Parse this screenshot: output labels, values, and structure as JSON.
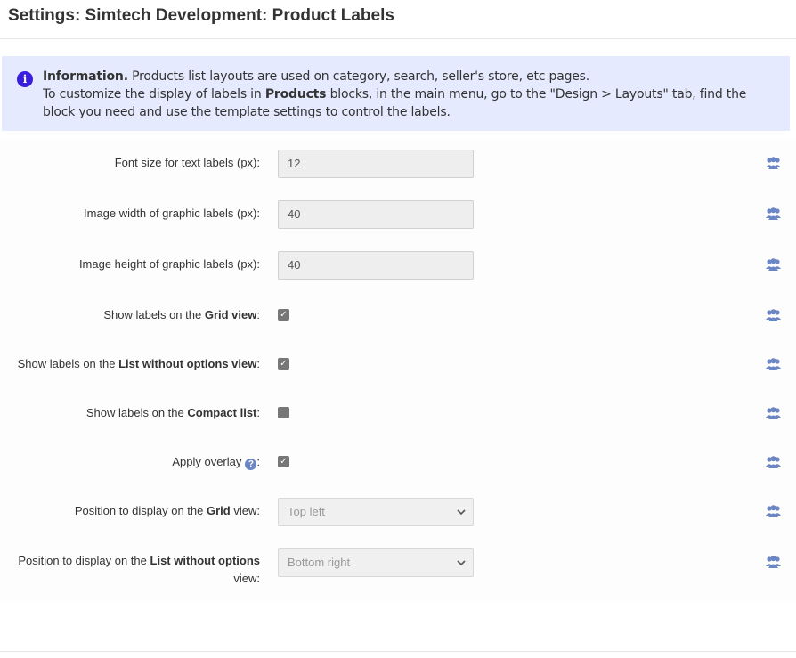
{
  "title": "Settings: Simtech Development: Product Labels",
  "info": {
    "heading": "Information.",
    "line1": "Products list layouts are used on category, search, seller's store, etc pages.",
    "line2_prefix": "To customize the display of labels in",
    "line2_bold": "Products",
    "line2_suffix": "blocks, in the main menu, go to the \"Design > Layouts\" tab, find the block you need and use the template settings to control the labels."
  },
  "settings": {
    "font_size": {
      "label": "Font size for text labels (px):",
      "value": "12"
    },
    "image_width": {
      "label": "Image width of graphic labels (px):",
      "value": "40"
    },
    "image_height": {
      "label": "Image height of graphic labels (px):",
      "value": "40"
    },
    "grid_view": {
      "prefix": "Show labels on the",
      "bold": "Grid view",
      "suffix": ":",
      "checked": true
    },
    "list_without_options": {
      "prefix": "Show labels on the",
      "bold": "List without options view",
      "suffix": ":",
      "checked": true
    },
    "compact_list": {
      "prefix": "Show labels on the",
      "bold": "Compact list",
      "suffix": ":",
      "checked": false
    },
    "apply_overlay": {
      "label": "Apply overlay",
      "suffix": ":",
      "checked": true
    },
    "position_grid": {
      "prefix": "Position to display on the",
      "bold": "Grid",
      "suffix": "view:",
      "value": "Top left"
    },
    "position_list": {
      "prefix": "Position to display on the",
      "bold": "List without options",
      "suffix": "view:",
      "value": "Bottom right"
    }
  },
  "icons": {
    "check": "✓",
    "help": "?",
    "chevron": "⌄",
    "info": "i",
    "users": "users-icon"
  },
  "colors": {
    "info_bg": "#e6eaff",
    "info_icon": "#3a1ee0",
    "users_icon": "#6b86c4"
  }
}
